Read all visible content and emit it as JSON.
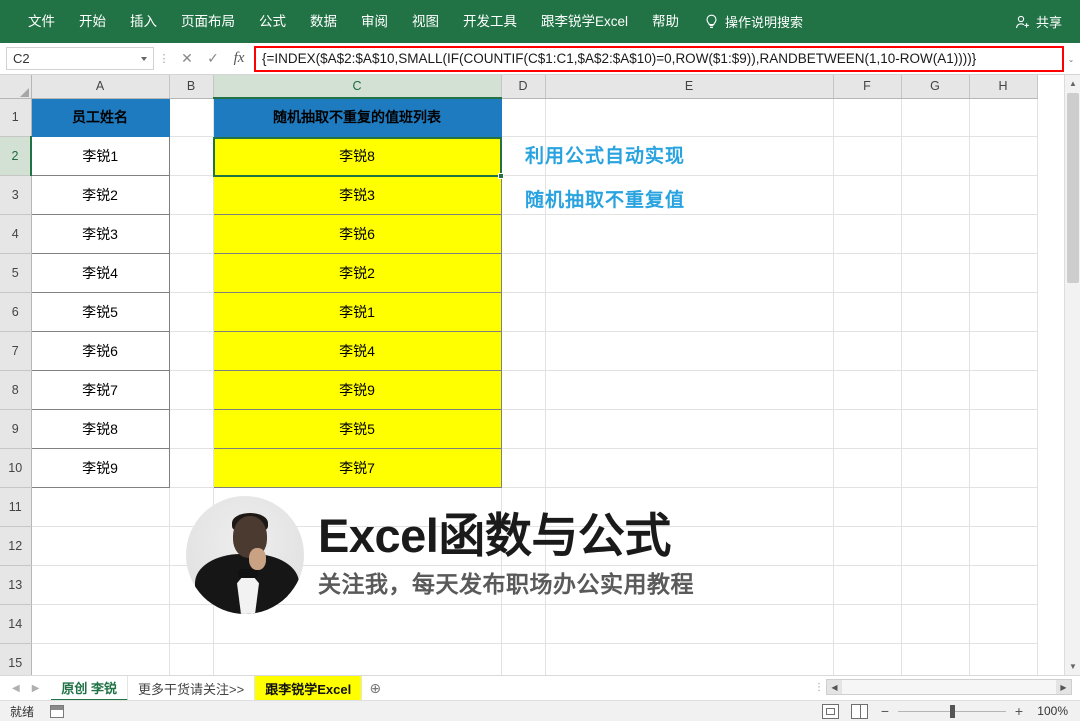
{
  "ribbon": {
    "tabs": [
      "文件",
      "开始",
      "插入",
      "页面布局",
      "公式",
      "数据",
      "审阅",
      "视图",
      "开发工具",
      "跟李锐学Excel",
      "帮助"
    ],
    "tell_me": "操作说明搜索",
    "share_label": "共享"
  },
  "formula_bar": {
    "name_box": "C2",
    "formula": "{=INDEX($A$2:$A$10,SMALL(IF(COUNTIF(C$1:C1,$A$2:$A$10)=0,ROW($1:$9)),RANDBETWEEN(1,10-ROW(A1))))}",
    "cancel_icon": "✕",
    "confirm_icon": "✓",
    "function_icon": "fx",
    "expand_icon": "⌄"
  },
  "grid": {
    "columns": [
      "A",
      "B",
      "C",
      "D",
      "E",
      "F",
      "G",
      "H"
    ],
    "selected_column": "C",
    "rows": [
      "1",
      "2",
      "3",
      "4",
      "5",
      "6",
      "7",
      "8",
      "9",
      "10",
      "11",
      "12",
      "13",
      "14",
      "15"
    ],
    "selected_row": "2",
    "headers": {
      "a1": "员工姓名",
      "c1": "随机抽取不重复的值班列表"
    },
    "column_a": [
      "李锐1",
      "李锐2",
      "李锐3",
      "李锐4",
      "李锐5",
      "李锐6",
      "李锐7",
      "李锐8",
      "李锐9"
    ],
    "column_c": [
      "李锐8",
      "李锐3",
      "李锐6",
      "李锐2",
      "李锐1",
      "李锐4",
      "李锐9",
      "李锐5",
      "李锐7"
    ],
    "annotation": {
      "line1": "利用公式自动实现",
      "line2": "随机抽取不重复值"
    }
  },
  "watermark": {
    "title": "Excel函数与公式",
    "subtitle": "关注我，每天发布职场办公实用教程"
  },
  "sheet_tabs": {
    "prev_icon": "◀",
    "next_icon": "▶",
    "tabs": [
      {
        "label": "原创 李锐",
        "state": "active"
      },
      {
        "label": "更多干货请关注>>",
        "state": "normal"
      },
      {
        "label": "跟李锐学Excel",
        "state": "yellow"
      }
    ],
    "add_icon": "⊕"
  },
  "status_bar": {
    "status": "就绪",
    "zoom": "100%",
    "zoom_minus": "−",
    "zoom_plus": "+"
  },
  "colors": {
    "ribbon_green": "#217346",
    "header_blue": "#1e7bc0",
    "cell_yellow": "#ffff00",
    "annotation_blue": "#29a3e0",
    "formula_outline_red": "#ff0000"
  }
}
